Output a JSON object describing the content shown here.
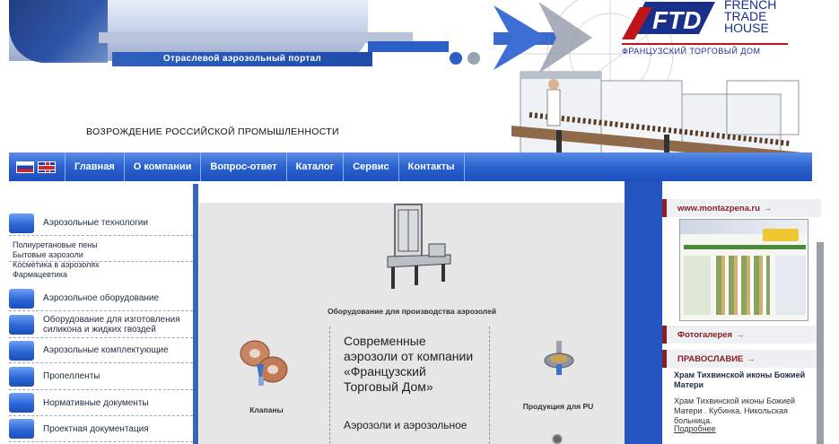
{
  "header": {
    "portal_subtitle": "Отраслевой аэрозольный портал",
    "slogan": "ВОЗРОЖДЕНИЕ РОССИЙСКОЙ ПРОМЫШЛЕННОСТИ",
    "logo": {
      "mark": "FTD",
      "line1": "FRENCH",
      "line2": "TRADE",
      "line3": "HOUSE",
      "subtitle": "ФРАНЦУЗСКИЙ ТОРГОВЫЙ ДОМ"
    }
  },
  "nav": {
    "flags": [
      "flag-russia-icon",
      "flag-uk-icon"
    ],
    "items": [
      "Главная",
      "О компании",
      "Вопрос-ответ",
      "Каталог",
      "Сервис",
      "Контакты"
    ]
  },
  "sidebar": {
    "items": [
      {
        "label": "Аэрозольные технологии"
      },
      {
        "label": "Аэрозольное оборудование"
      },
      {
        "label": "Оборудование для изготовления силикона и жидких гвоздей"
      },
      {
        "label": "Аэрозольные комплектующие"
      },
      {
        "label": "Пропелленты"
      },
      {
        "label": "Нормативные документы"
      },
      {
        "label": "Проектная документация"
      }
    ],
    "subitems": [
      "Полиуретановые пены",
      "Бытовые аэрозоли",
      "Косметика в аэрозолях",
      "Фармацевтика"
    ]
  },
  "main": {
    "equipment_caption": "Оборудование для производства аэрозолей",
    "valves_caption": "Клапаны",
    "pu_caption": "Продукция для PU",
    "headline": "Современные аэрозоли от компании «Французский Торговый Дом»",
    "subheadline": "Аэрозоли и аэрозольное"
  },
  "right": {
    "site_link": "www.montazpena.ru",
    "photo_gallery": "Фотогалерея",
    "orthodoxy": "ПРАВОСЛАВИЕ",
    "news_title": "Храм Тихвинской иконы Божией Матери",
    "news_text": "Храм Тихвинской иконы Божией Матери . Кубинка. Никольская больница.",
    "more_link": "Подробнее",
    "arrow": "→"
  },
  "colors": {
    "nav_blue": "#2a62d0",
    "dark_blue": "#1a2f8a",
    "accent_red": "#8c1d24",
    "panel_gray": "#e6e6e6"
  }
}
